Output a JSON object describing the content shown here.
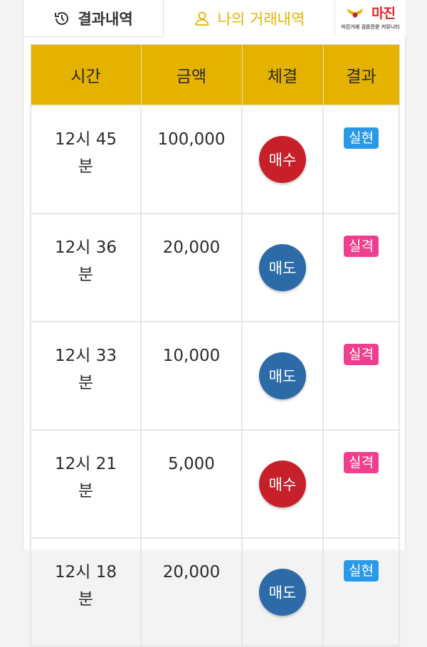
{
  "tabs": {
    "history_label": "결과내역",
    "my_trades_label": "나의 거래내역"
  },
  "logo": {
    "name": "마진",
    "sub": "마진거래 검증전문 커뮤니티"
  },
  "colors": {
    "header_bg": "#e6b200",
    "active_tab": "#e3b200",
    "buy": "#c8202a",
    "sell": "#2d6aa8",
    "realized": "#2a99e6",
    "loss": "#ee3f8e"
  },
  "table": {
    "headers": [
      "시간",
      "금액",
      "체결",
      "결과"
    ],
    "rows": [
      {
        "time_h": "12시 45",
        "time_m": "분",
        "amount": "100,000",
        "exec": "매수",
        "result": "실현"
      },
      {
        "time_h": "12시 36",
        "time_m": "분",
        "amount": "20,000",
        "exec": "매도",
        "result": "실격"
      },
      {
        "time_h": "12시 33",
        "time_m": "분",
        "amount": "10,000",
        "exec": "매도",
        "result": "실격"
      },
      {
        "time_h": "12시 21",
        "time_m": "분",
        "amount": "5,000",
        "exec": "매수",
        "result": "실격"
      },
      {
        "time_h": "12시 18",
        "time_m": "분",
        "amount": "20,000",
        "exec": "매도",
        "result": "실현"
      }
    ]
  }
}
